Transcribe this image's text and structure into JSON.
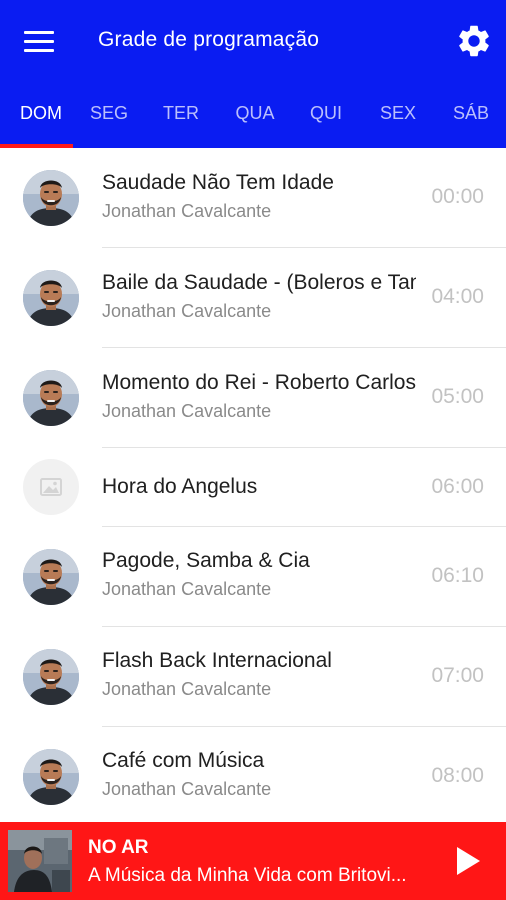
{
  "header": {
    "title": "Grade de programação",
    "menu_icon": "hamburger-menu-icon",
    "settings_icon": "gear-icon",
    "background_color": "#0a1cf2"
  },
  "tabs": [
    {
      "label": "DOM",
      "active": true
    },
    {
      "label": "SEG",
      "active": false
    },
    {
      "label": "TER",
      "active": false
    },
    {
      "label": "QUA",
      "active": false
    },
    {
      "label": "QUI",
      "active": false
    },
    {
      "label": "SEX",
      "active": false
    },
    {
      "label": "SÁB",
      "active": false
    }
  ],
  "tab_indicator_color": "#ff1a1a",
  "schedule": [
    {
      "title": "Saudade Não Tem Idade",
      "host": "Jonathan Cavalcante",
      "time": "00:00",
      "avatar": "host-photo"
    },
    {
      "title": "Baile da Saudade - (Boleros e Tangos)",
      "host": "Jonathan Cavalcante",
      "time": "04:00",
      "avatar": "host-photo"
    },
    {
      "title": "Momento do Rei - Roberto Carlos",
      "host": "Jonathan Cavalcante",
      "time": "05:00",
      "avatar": "host-photo"
    },
    {
      "title": "Hora do Angelus",
      "host": "",
      "time": "06:00",
      "avatar": "image-placeholder-icon"
    },
    {
      "title": "Pagode, Samba & Cia",
      "host": "Jonathan Cavalcante",
      "time": "06:10",
      "avatar": "host-photo"
    },
    {
      "title": "Flash Back Internacional",
      "host": "Jonathan Cavalcante",
      "time": "07:00",
      "avatar": "host-photo"
    },
    {
      "title": "Café com Música",
      "host": "Jonathan Cavalcante",
      "time": "08:00",
      "avatar": "host-photo"
    }
  ],
  "player": {
    "label": "NO AR",
    "track": "A Música da Minha Vida com Britovi...",
    "play_icon": "play-icon",
    "background_color": "#ff1616"
  }
}
